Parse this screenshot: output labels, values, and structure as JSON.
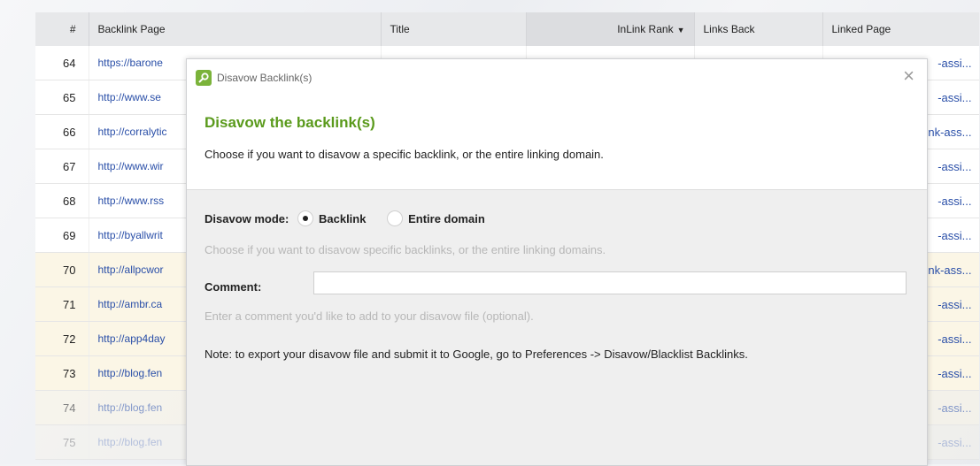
{
  "table": {
    "headers": {
      "num": "#",
      "backlink_page": "Backlink Page",
      "title": "Title",
      "inlink_rank": "InLink Rank",
      "links_back": "Links Back",
      "linked_page": "Linked Page"
    },
    "rows": [
      {
        "num": "64",
        "url": "https://barone",
        "linked": "-assi..."
      },
      {
        "num": "65",
        "url": "http://www.se",
        "linked": "-assi..."
      },
      {
        "num": "66",
        "url": "http://corralytic",
        "linked": "nk-ass..."
      },
      {
        "num": "67",
        "url": "http://www.wir",
        "linked": "-assi..."
      },
      {
        "num": "68",
        "url": "http://www.rss",
        "linked": "-assi..."
      },
      {
        "num": "69",
        "url": "http://byallwrit",
        "linked": "-assi..."
      },
      {
        "num": "70",
        "url": "http://allpcwor",
        "linked": "nk-ass..."
      },
      {
        "num": "71",
        "url": "http://ambr.ca",
        "linked": "-assi..."
      },
      {
        "num": "72",
        "url": "http://app4day",
        "linked": "-assi..."
      },
      {
        "num": "73",
        "url": "http://blog.fen",
        "linked": "-assi..."
      },
      {
        "num": "74",
        "url": "http://blog.fen",
        "linked": "-assi..."
      },
      {
        "num": "75",
        "url": "http://blog.fen",
        "linked": "-assi..."
      }
    ]
  },
  "dialog": {
    "window_title": "Disavow Backlink(s)",
    "close_glyph": "×",
    "heading": "Disavow the backlink(s)",
    "description": "Choose if you want to disavow a specific backlink, or the entire linking domain.",
    "mode_label": "Disavow mode:",
    "option_backlink": "Backlink",
    "option_domain": "Entire domain",
    "mode_hint": "Choose if you want to disavow specific backlinks, or the entire linking domains.",
    "comment_label": "Comment:",
    "comment_value": "",
    "comment_hint": "Enter a comment you'd like to add to your disavow file (optional).",
    "note": "Note: to export your disavow file and submit it to Google, go to Preferences -> Disavow/Blacklist Backlinks."
  },
  "colors": {
    "accent_green": "#5a9a1c",
    "link_blue": "#2a4fa8",
    "highlight_row": "#fbf6e6"
  }
}
